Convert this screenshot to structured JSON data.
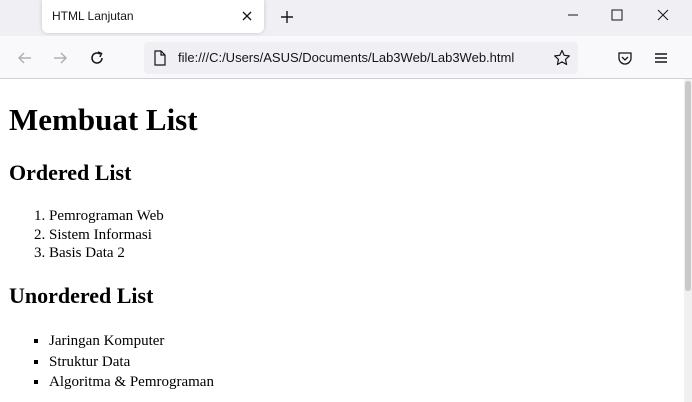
{
  "browser": {
    "tab_title": "HTML Lanjutan",
    "url": "file:///C:/Users/ASUS/Documents/Lab3Web/Lab3Web.html"
  },
  "page": {
    "heading": "Membuat List",
    "ordered_heading": "Ordered List",
    "ordered_items": [
      "Pemrograman Web",
      "Sistem Informasi",
      "Basis Data 2"
    ],
    "unordered_heading": "Unordered List",
    "unordered_items": [
      "Jaringan Komputer",
      "Struktur Data",
      "Algoritma & Pemrograman"
    ]
  },
  "icons": {
    "back": "back-arrow-icon",
    "forward": "forward-arrow-icon",
    "reload": "reload-icon",
    "page": "page-icon",
    "bookmark": "star-icon",
    "pocket": "pocket-icon",
    "menu": "hamburger-menu-icon"
  }
}
